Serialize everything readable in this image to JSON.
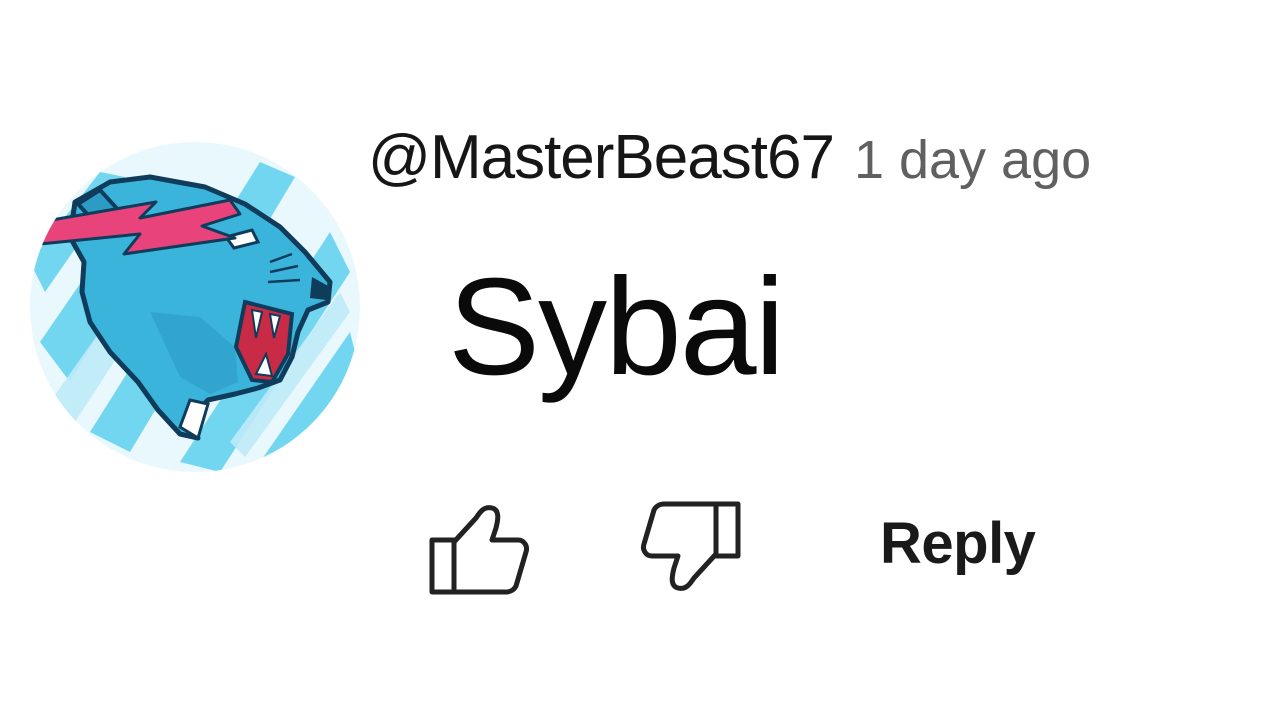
{
  "comment": {
    "author": "@MasterBeast67",
    "timestamp": "1 day ago",
    "text": "Sybai",
    "avatar_icon": "panther-logo-icon"
  },
  "actions": {
    "like_icon": "thumbs-up-icon",
    "dislike_icon": "thumbs-down-icon",
    "reply_label": "Reply"
  },
  "colors": {
    "avatar_background": "#e6f7fd",
    "avatar_streak": "#5fd0ef",
    "panther_body": "#3bb4dc",
    "panther_outline": "#0f3c5a",
    "bolt": "#e8437a",
    "author_text": "#161616",
    "timestamp_text": "#606060",
    "comment_text": "#0a0a0a"
  }
}
